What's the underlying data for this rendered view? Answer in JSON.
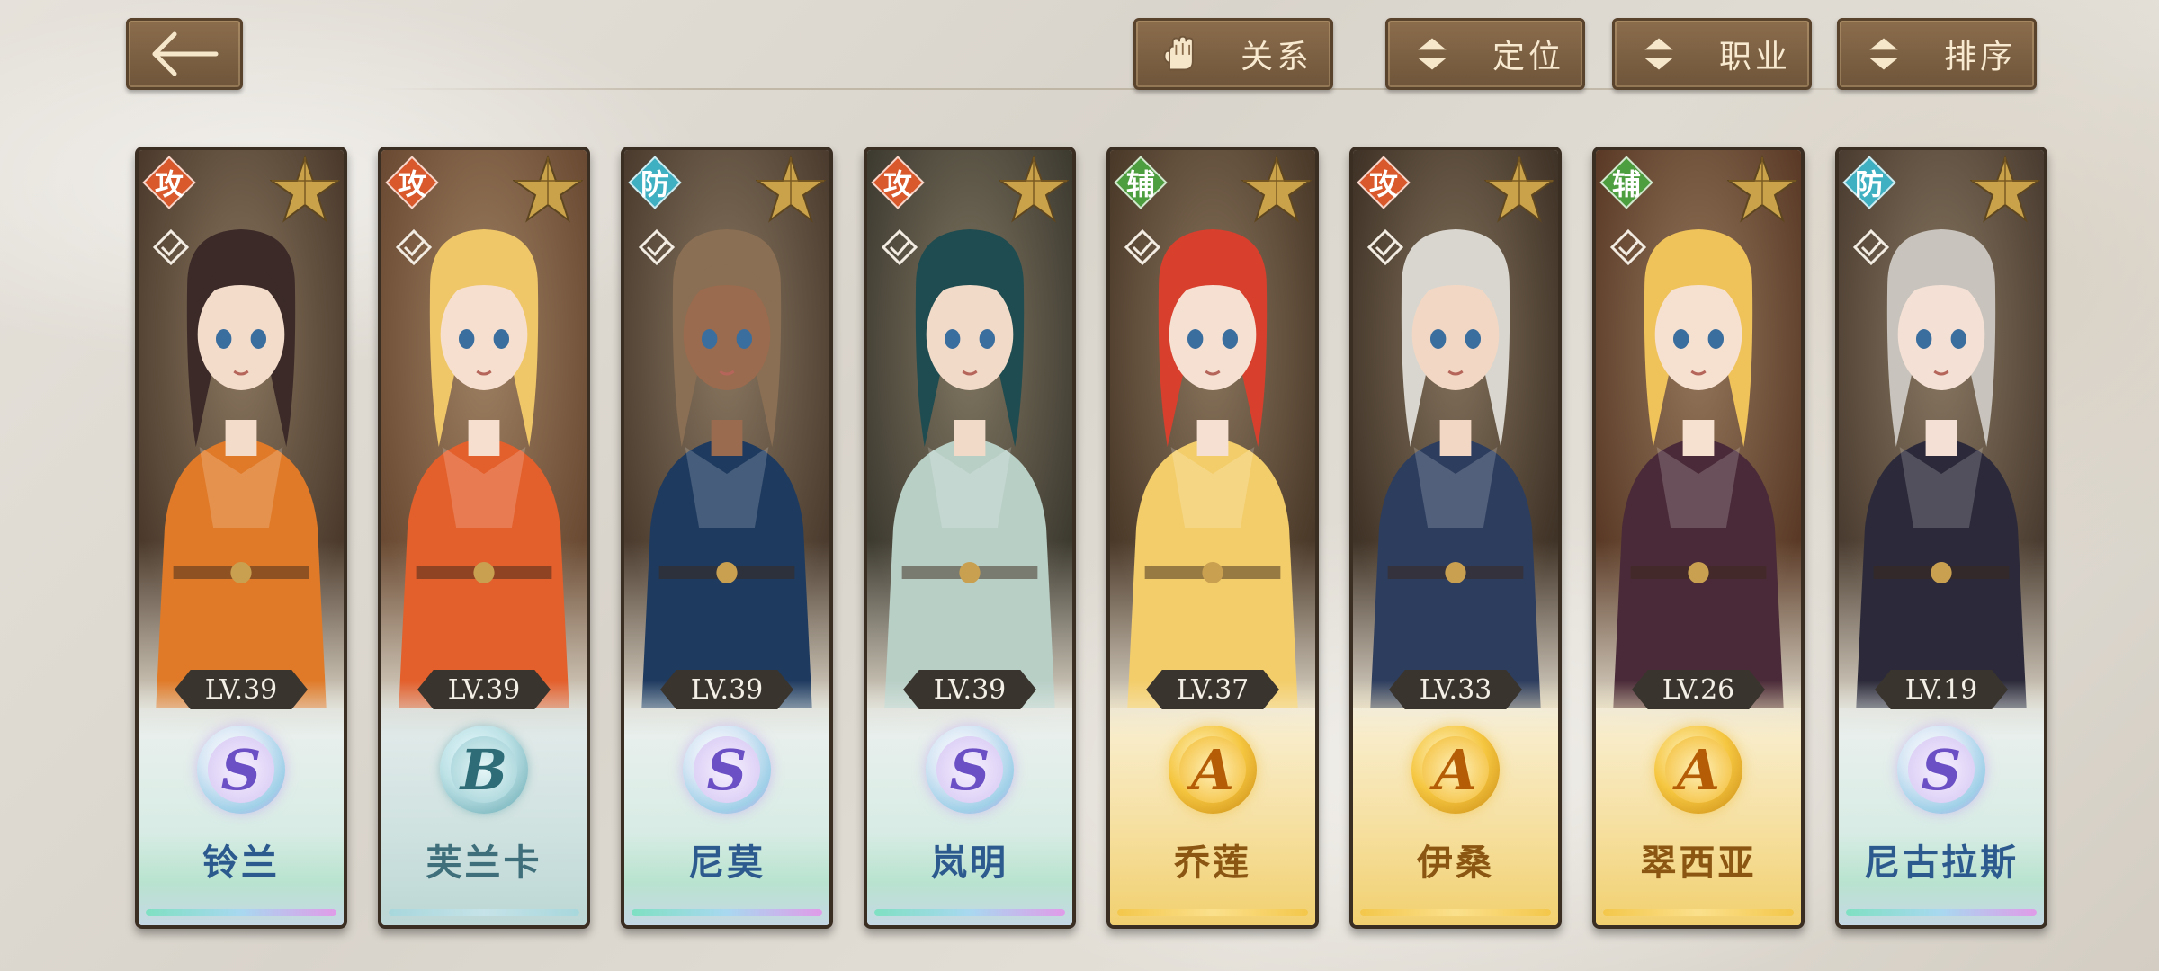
{
  "toolbar": {
    "back_icon": "arrow-left-icon",
    "buttons": [
      {
        "label": "关系",
        "icon": "glove-icon"
      },
      {
        "label": "定位",
        "icon": "sort-arrows-icon"
      },
      {
        "label": "职业",
        "icon": "sort-arrows-icon"
      },
      {
        "label": "排序",
        "icon": "sort-arrows-icon"
      }
    ]
  },
  "characters": [
    {
      "role": "攻",
      "level": "LV.39",
      "rank": "S",
      "name": "铃兰",
      "palette": {
        "hair": "#3b2a28",
        "outfit": "#e07a28",
        "bg": "#4b3a2c",
        "skin": "#f4dccb"
      }
    },
    {
      "role": "攻",
      "level": "LV.39",
      "rank": "B",
      "name": "芙兰卡",
      "palette": {
        "hair": "#f0c768",
        "outfit": "#e35f2b",
        "bg": "#6a4a32",
        "skin": "#f6dfcf"
      }
    },
    {
      "role": "防",
      "level": "LV.39",
      "rank": "S",
      "name": "尼莫",
      "palette": {
        "hair": "#8a6f54",
        "outfit": "#1e3a5f",
        "bg": "#4a3b2e",
        "skin": "#9a6b4e"
      }
    },
    {
      "role": "攻",
      "level": "LV.39",
      "rank": "S",
      "name": "岚明",
      "palette": {
        "hair": "#1f4c50",
        "outfit": "#b8cfc6",
        "bg": "#3d3a30",
        "skin": "#f2dac8"
      }
    },
    {
      "role": "辅",
      "level": "LV.37",
      "rank": "A",
      "name": "乔莲",
      "palette": {
        "hair": "#d8402d",
        "outfit": "#f3cd6a",
        "bg": "#4a3828",
        "skin": "#f6e0d2"
      }
    },
    {
      "role": "攻",
      "level": "LV.33",
      "rank": "A",
      "name": "伊桑",
      "palette": {
        "hair": "#d9d6cf",
        "outfit": "#2d3d5e",
        "bg": "#3f3226",
        "skin": "#f2d8c4"
      }
    },
    {
      "role": "辅",
      "level": "LV.26",
      "rank": "A",
      "name": "翠西亚",
      "palette": {
        "hair": "#f0c25a",
        "outfit": "#4a2a38",
        "bg": "#5a3a26",
        "skin": "#f6e0d0"
      }
    },
    {
      "role": "防",
      "level": "LV.19",
      "rank": "S",
      "name": "尼古拉斯",
      "palette": {
        "hair": "#c8c4bd",
        "outfit": "#2c2a3a",
        "bg": "#4a3c30",
        "skin": "#f4e0d4"
      }
    }
  ]
}
